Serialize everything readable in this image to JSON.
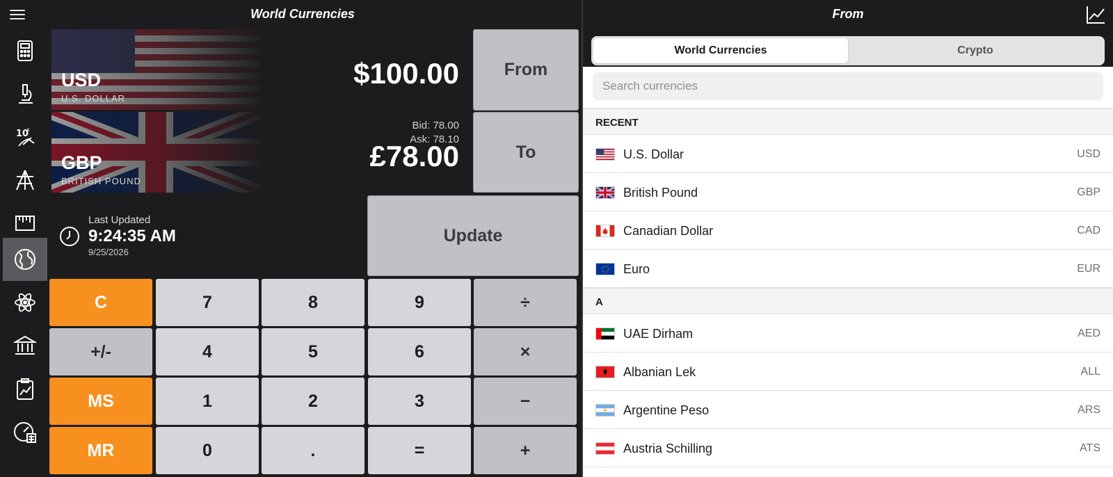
{
  "left": {
    "title": "World Currencies",
    "menu_icon": "hamburger-menu-icon",
    "sidebar": [
      {
        "icon": "calculator-icon"
      },
      {
        "icon": "microscope-icon"
      },
      {
        "icon": "exponent-hand-icon"
      },
      {
        "icon": "structure-icon"
      },
      {
        "icon": "ruler-icon"
      },
      {
        "icon": "globe-icon",
        "active": true
      },
      {
        "icon": "atom-icon"
      },
      {
        "icon": "bank-icon"
      },
      {
        "icon": "clipboard-chart-icon"
      },
      {
        "icon": "gauge-calculator-icon"
      }
    ],
    "from_currency": {
      "code": "USD",
      "name": "U.S. DOLLAR",
      "amount": "$100.00"
    },
    "to_currency": {
      "code": "GBP",
      "name": "BRITISH POUND",
      "amount": "£78.00",
      "bid": "Bid: 78.00",
      "ask": "Ask: 78.10"
    },
    "from_button": "From",
    "to_button": "To",
    "update_button": "Update",
    "last_updated": {
      "label": "Last Updated",
      "time": "9:24:35 AM",
      "date": "9/25/2026"
    },
    "keypad": {
      "clear": "C",
      "plus_minus": "+/-",
      "ms": "MS",
      "mr": "MR",
      "k7": "7",
      "k8": "8",
      "k9": "9",
      "div": "÷",
      "k4": "4",
      "k5": "5",
      "k6": "6",
      "mul": "×",
      "k1": "1",
      "k2": "2",
      "k3": "3",
      "sub": "−",
      "k0": "0",
      "dot": ".",
      "eq": "=",
      "add": "+"
    },
    "colors": {
      "orange": "#f7901e",
      "key_gray": "#d5d6d9",
      "op_gray": "#c0c1c5",
      "dark_bg": "#1c1c1e"
    }
  },
  "right": {
    "title": "From",
    "chart_icon": "line-chart-icon",
    "tabs": [
      {
        "label": "World Currencies",
        "selected": true
      },
      {
        "label": "Crypto",
        "selected": false
      }
    ],
    "search_placeholder": "Search currencies",
    "recent_header": "RECENT",
    "recent": [
      {
        "name": "U.S. Dollar",
        "code": "USD"
      },
      {
        "name": "British Pound",
        "code": "GBP"
      },
      {
        "name": "Canadian Dollar",
        "code": "CAD"
      },
      {
        "name": "Euro",
        "code": "EUR"
      }
    ],
    "a_header": "A",
    "a_list": [
      {
        "name": "UAE Dirham",
        "code": "AED"
      },
      {
        "name": "Albanian Lek",
        "code": "ALL"
      },
      {
        "name": "Argentine Peso",
        "code": "ARS"
      },
      {
        "name": "Austria Schilling",
        "code": "ATS"
      }
    ]
  }
}
